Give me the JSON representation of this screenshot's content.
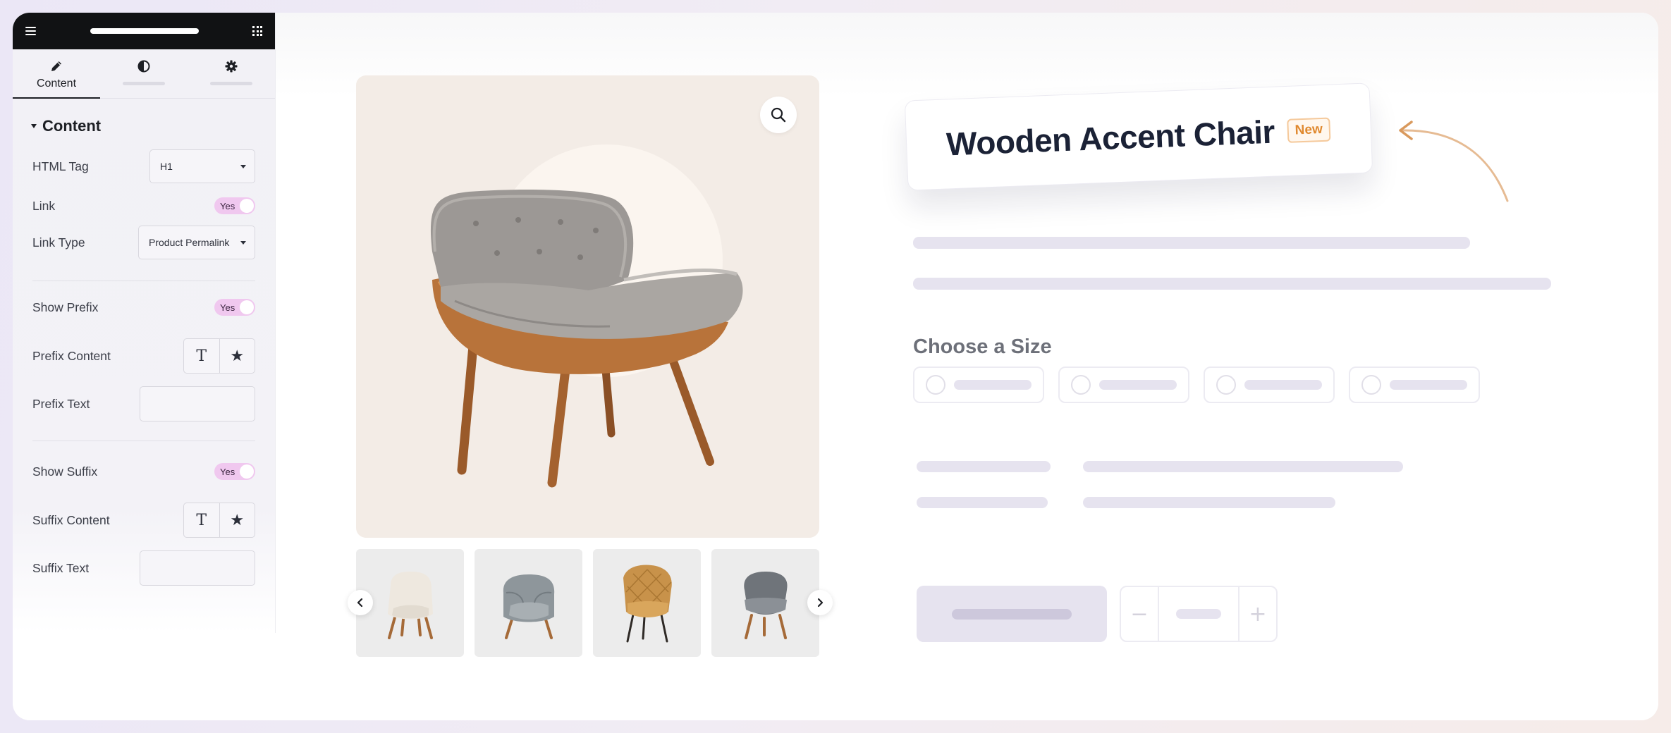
{
  "editor": {
    "tabs": [
      {
        "label": "Content",
        "icon": "pencil-icon",
        "active": true
      },
      {
        "label": "",
        "icon": "half-circle-icon",
        "active": false
      },
      {
        "label": "",
        "icon": "gear-icon",
        "active": false
      }
    ],
    "section_title": "Content",
    "controls": {
      "html_tag": {
        "label": "HTML Tag",
        "value": "H1"
      },
      "link": {
        "label": "Link",
        "value": "Yes"
      },
      "link_type": {
        "label": "Link Type",
        "value": "Product Permalink"
      },
      "show_prefix": {
        "label": "Show Prefix",
        "value": "Yes"
      },
      "prefix_content": {
        "label": "Prefix Content",
        "options": [
          "T",
          "★"
        ]
      },
      "prefix_text": {
        "label": "Prefix Text",
        "value": ""
      },
      "show_suffix": {
        "label": "Show Suffix",
        "value": "Yes"
      },
      "suffix_content": {
        "label": "Suffix Content",
        "options": [
          "T",
          "★"
        ]
      },
      "suffix_text": {
        "label": "Suffix Text",
        "value": ""
      }
    },
    "accent_toggle_color": "#f0c8ef"
  },
  "product": {
    "title": "Wooden Accent Chair",
    "badge": "New",
    "badge_color": "#e0892f",
    "size_heading": "Choose a Size",
    "size_options_count": 4,
    "thumbnails": [
      "cream-chair",
      "grey-velvet-chair",
      "mustard-chair",
      "grey-shell-chair"
    ]
  },
  "colors": {
    "skeleton": "#e6e3ef",
    "main_image_bg": "#f3ece6"
  }
}
